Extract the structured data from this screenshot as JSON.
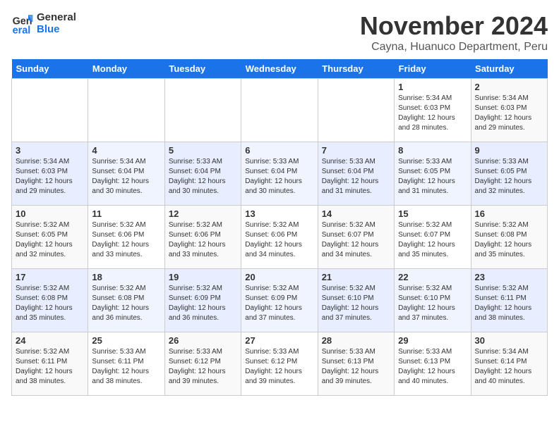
{
  "logo": {
    "line1": "General",
    "line2": "Blue"
  },
  "title": "November 2024",
  "location": "Cayna, Huanuco Department, Peru",
  "weekdays": [
    "Sunday",
    "Monday",
    "Tuesday",
    "Wednesday",
    "Thursday",
    "Friday",
    "Saturday"
  ],
  "weeks": [
    [
      {
        "day": "",
        "info": ""
      },
      {
        "day": "",
        "info": ""
      },
      {
        "day": "",
        "info": ""
      },
      {
        "day": "",
        "info": ""
      },
      {
        "day": "",
        "info": ""
      },
      {
        "day": "1",
        "info": "Sunrise: 5:34 AM\nSunset: 6:03 PM\nDaylight: 12 hours and 28 minutes."
      },
      {
        "day": "2",
        "info": "Sunrise: 5:34 AM\nSunset: 6:03 PM\nDaylight: 12 hours and 29 minutes."
      }
    ],
    [
      {
        "day": "3",
        "info": "Sunrise: 5:34 AM\nSunset: 6:03 PM\nDaylight: 12 hours and 29 minutes."
      },
      {
        "day": "4",
        "info": "Sunrise: 5:34 AM\nSunset: 6:04 PM\nDaylight: 12 hours and 30 minutes."
      },
      {
        "day": "5",
        "info": "Sunrise: 5:33 AM\nSunset: 6:04 PM\nDaylight: 12 hours and 30 minutes."
      },
      {
        "day": "6",
        "info": "Sunrise: 5:33 AM\nSunset: 6:04 PM\nDaylight: 12 hours and 30 minutes."
      },
      {
        "day": "7",
        "info": "Sunrise: 5:33 AM\nSunset: 6:04 PM\nDaylight: 12 hours and 31 minutes."
      },
      {
        "day": "8",
        "info": "Sunrise: 5:33 AM\nSunset: 6:05 PM\nDaylight: 12 hours and 31 minutes."
      },
      {
        "day": "9",
        "info": "Sunrise: 5:33 AM\nSunset: 6:05 PM\nDaylight: 12 hours and 32 minutes."
      }
    ],
    [
      {
        "day": "10",
        "info": "Sunrise: 5:32 AM\nSunset: 6:05 PM\nDaylight: 12 hours and 32 minutes."
      },
      {
        "day": "11",
        "info": "Sunrise: 5:32 AM\nSunset: 6:06 PM\nDaylight: 12 hours and 33 minutes."
      },
      {
        "day": "12",
        "info": "Sunrise: 5:32 AM\nSunset: 6:06 PM\nDaylight: 12 hours and 33 minutes."
      },
      {
        "day": "13",
        "info": "Sunrise: 5:32 AM\nSunset: 6:06 PM\nDaylight: 12 hours and 34 minutes."
      },
      {
        "day": "14",
        "info": "Sunrise: 5:32 AM\nSunset: 6:07 PM\nDaylight: 12 hours and 34 minutes."
      },
      {
        "day": "15",
        "info": "Sunrise: 5:32 AM\nSunset: 6:07 PM\nDaylight: 12 hours and 35 minutes."
      },
      {
        "day": "16",
        "info": "Sunrise: 5:32 AM\nSunset: 6:08 PM\nDaylight: 12 hours and 35 minutes."
      }
    ],
    [
      {
        "day": "17",
        "info": "Sunrise: 5:32 AM\nSunset: 6:08 PM\nDaylight: 12 hours and 35 minutes."
      },
      {
        "day": "18",
        "info": "Sunrise: 5:32 AM\nSunset: 6:08 PM\nDaylight: 12 hours and 36 minutes."
      },
      {
        "day": "19",
        "info": "Sunrise: 5:32 AM\nSunset: 6:09 PM\nDaylight: 12 hours and 36 minutes."
      },
      {
        "day": "20",
        "info": "Sunrise: 5:32 AM\nSunset: 6:09 PM\nDaylight: 12 hours and 37 minutes."
      },
      {
        "day": "21",
        "info": "Sunrise: 5:32 AM\nSunset: 6:10 PM\nDaylight: 12 hours and 37 minutes."
      },
      {
        "day": "22",
        "info": "Sunrise: 5:32 AM\nSunset: 6:10 PM\nDaylight: 12 hours and 37 minutes."
      },
      {
        "day": "23",
        "info": "Sunrise: 5:32 AM\nSunset: 6:11 PM\nDaylight: 12 hours and 38 minutes."
      }
    ],
    [
      {
        "day": "24",
        "info": "Sunrise: 5:32 AM\nSunset: 6:11 PM\nDaylight: 12 hours and 38 minutes."
      },
      {
        "day": "25",
        "info": "Sunrise: 5:33 AM\nSunset: 6:11 PM\nDaylight: 12 hours and 38 minutes."
      },
      {
        "day": "26",
        "info": "Sunrise: 5:33 AM\nSunset: 6:12 PM\nDaylight: 12 hours and 39 minutes."
      },
      {
        "day": "27",
        "info": "Sunrise: 5:33 AM\nSunset: 6:12 PM\nDaylight: 12 hours and 39 minutes."
      },
      {
        "day": "28",
        "info": "Sunrise: 5:33 AM\nSunset: 6:13 PM\nDaylight: 12 hours and 39 minutes."
      },
      {
        "day": "29",
        "info": "Sunrise: 5:33 AM\nSunset: 6:13 PM\nDaylight: 12 hours and 40 minutes."
      },
      {
        "day": "30",
        "info": "Sunrise: 5:34 AM\nSunset: 6:14 PM\nDaylight: 12 hours and 40 minutes."
      }
    ]
  ]
}
